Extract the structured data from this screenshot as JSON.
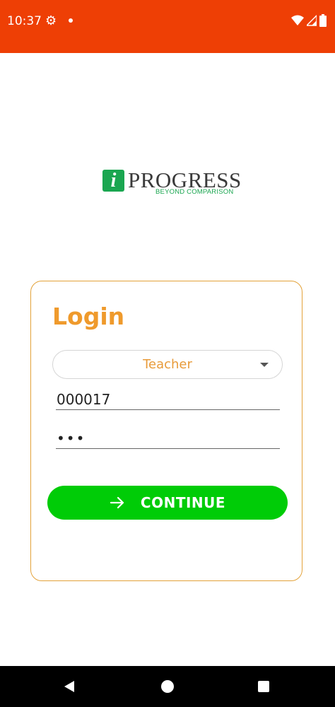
{
  "status_bar": {
    "time": "10:37",
    "icons": [
      "gear-icon",
      "notification-dot",
      "wifi-icon",
      "signal-icon",
      "battery-icon"
    ],
    "background": "#ee3f05"
  },
  "logo": {
    "letter": "i",
    "word": "PROGRESS",
    "tagline": "BEYOND COMPARISON",
    "accent": "#1aa650"
  },
  "login": {
    "title": "Login",
    "role_value": "Teacher",
    "username_value": "000017",
    "password_value": "•••",
    "continue_label": "CONTINUE",
    "accent": "#ef9a2c",
    "button_color": "#00cc07"
  },
  "nav_bar": {
    "icons": [
      "back-icon",
      "home-icon",
      "recents-icon"
    ]
  }
}
